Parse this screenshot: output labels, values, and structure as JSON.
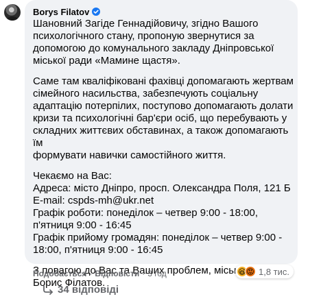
{
  "comment": {
    "author": "Borys Filatov",
    "verified_icon": "verified-badge-icon",
    "paragraphs": [
      {
        "lines": [
          "Шановний Загіде Геннадійовичу, згідно Вашого",
          "психологічного стану, пропоную звернутися за",
          "допомогою до комунального закладу Дніпровської",
          "міської ради «Мамине щастя»."
        ]
      },
      {
        "lines": [
          "Саме там кваліфіковані фахівці допомагають жертвам",
          "сімейного насильства, забезпечують соціальну",
          "адаптацію потерпілих, поступово допомагають долати",
          "кризи та психологічні бар'єри осіб, що перебувають у",
          "складних життєвих обставинах, а також допомагають",
          "їм",
          "формувати навички самостійного життя."
        ]
      },
      {
        "lines": [
          "Чекаємо на Вас:",
          "Адреса: місто Дніпро, просп. Олександра Поля, 121 Б",
          "E-mail: cspds-mh@ukr.net",
          "Графік роботи: понеділок – четвер 9:00 - 18:00,",
          "п'ятниця 9:00 - 16:45",
          "Графік прийому громадян: понеділок – четвер 9:00 -",
          "18:00, п'ятниця 9:00 - 16:45"
        ]
      },
      {
        "lines": [
          "З повагою до Вас та Ваших проблем, міський голова",
          "Борис Філатов."
        ]
      }
    ],
    "reactions": {
      "icons": [
        "laugh-emoji-icon",
        "angry-emoji-icon"
      ],
      "laugh_glyph": "😆",
      "angry_glyph": "😡",
      "count": "1,8 тис."
    },
    "actions": {
      "like": "Подобається",
      "separator": "·",
      "reply": "Відповісти",
      "time": "3 год"
    },
    "replies_label": "34 відповіді"
  },
  "colors": {
    "bubble": "#f0f2f5",
    "text": "#050505",
    "secondary": "#65676b",
    "verified": "#1877f2"
  }
}
